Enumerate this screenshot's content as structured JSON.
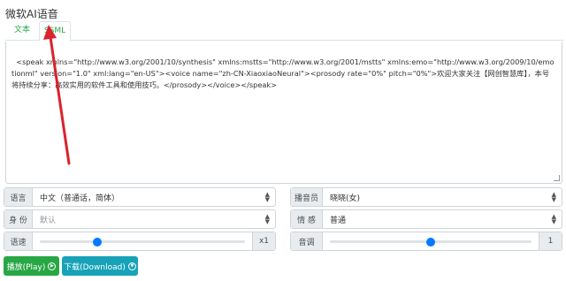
{
  "app": {
    "title": "微软AI语音"
  },
  "tabs": [
    {
      "label": "文本",
      "active": false
    },
    {
      "label": "SSML",
      "active": true
    }
  ],
  "editor": {
    "content": "<speak xmlns=\"http://www.w3.org/2001/10/synthesis\" xmlns:mstts=\"http://www.w3.org/2001/mstts\" xmlns:emo=\"http://www.w3.org/2009/10/emotionml\" version=\"1.0\" xml:lang=\"en-US\"><voice name=\"zh-CN-XiaoxiaoNeural\"><prosody rate=\"0%\" pitch=\"0%\">欢迎大家关注【网创智慧库】，本号将持续分享：高效实用的软件工具和使用技巧。</prosody></voice></speak>"
  },
  "controls": {
    "language": {
      "label": "语言",
      "value": "中文（普通话，简体）"
    },
    "speaker": {
      "label": "播音员",
      "value": "晓晓(女)"
    },
    "role": {
      "label": "身 份",
      "value": "默认"
    },
    "emotion": {
      "label": "情 感",
      "value": "普通"
    },
    "rate": {
      "label": "语速",
      "suffix": "x1",
      "position": 0.28
    },
    "pitch": {
      "label": "音调",
      "suffix": "1",
      "position": 0.5
    }
  },
  "buttons": {
    "play": "播放(Play)",
    "download": "下载(Download)"
  },
  "colors": {
    "accent_green": "#28a745",
    "accent_teal": "#17a2b8",
    "slider_blue": "#007bff",
    "annotation_red": "#d9232d"
  }
}
